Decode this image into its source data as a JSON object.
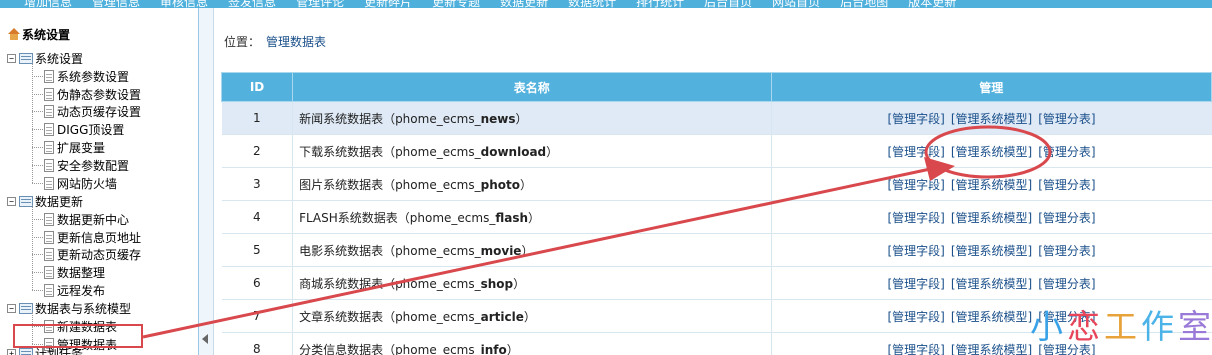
{
  "topnav": {
    "items": [
      "增加信息",
      "管理信息",
      "审核信息",
      "签发信息",
      "管理评论",
      "更新碎片",
      "更新专题",
      "数据更新",
      "数据统计",
      "排行统计",
      "后台首页",
      "网站首页",
      "后台地图",
      "版本更新"
    ]
  },
  "sidebar": {
    "root": "系统设置",
    "groups": [
      {
        "label": "系统设置",
        "items": [
          "系统参数设置",
          "伪静态参数设置",
          "动态页缓存设置",
          "DIGG顶设置",
          "扩展变量",
          "安全参数配置",
          "网站防火墙"
        ]
      },
      {
        "label": "数据更新",
        "items": [
          "数据更新中心",
          "更新信息页地址",
          "更新动态页缓存",
          "数据整理",
          "远程发布"
        ]
      },
      {
        "label": "数据表与系统模型",
        "items": [
          "新建数据表",
          "管理数据表"
        ]
      },
      {
        "label": "计划任务",
        "items": []
      }
    ]
  },
  "breadcrumb": {
    "prefix": "位置：",
    "current": "管理数据表"
  },
  "table": {
    "headers": [
      "ID",
      "表名称",
      "管理"
    ],
    "rows": [
      {
        "id": "1",
        "name": "新闻系统数据表（phome_ecms_",
        "suffix": "news",
        "close": "）"
      },
      {
        "id": "2",
        "name": "下载系统数据表（phome_ecms_",
        "suffix": "download",
        "close": "）"
      },
      {
        "id": "3",
        "name": "图片系统数据表（phome_ecms_",
        "suffix": "photo",
        "close": "）"
      },
      {
        "id": "4",
        "name": "FLASH系统数据表（phome_ecms_",
        "suffix": "flash",
        "close": "）"
      },
      {
        "id": "5",
        "name": "电影系统数据表（phome_ecms_",
        "suffix": "movie",
        "close": "）"
      },
      {
        "id": "6",
        "name": "商城系统数据表（phome_ecms_",
        "suffix": "shop",
        "close": "）"
      },
      {
        "id": "7",
        "name": "文章系统数据表（phome_ecms_",
        "suffix": "article",
        "close": "）"
      },
      {
        "id": "8",
        "name": "分类信息数据表（phome_ecms_",
        "suffix": "info",
        "close": "）"
      }
    ],
    "actions": [
      "[管理字段]",
      "[管理系统模型]",
      "[管理分表]"
    ]
  },
  "watermark": [
    "小",
    "恋",
    "工",
    "作",
    "室"
  ],
  "colors": {
    "header": "#52b1dd",
    "annotation": "#d8484c",
    "link": "#1a4f8a"
  }
}
